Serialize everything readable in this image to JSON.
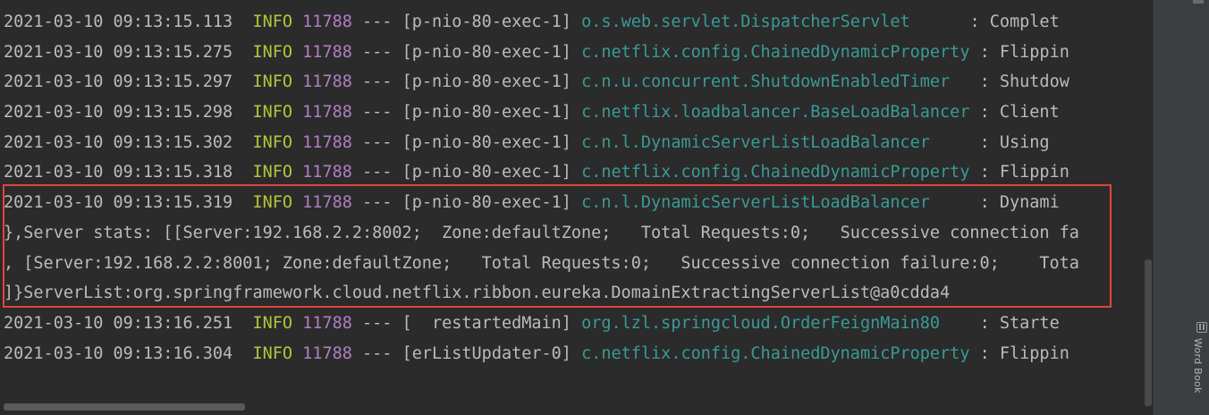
{
  "log_lines": [
    {
      "ts": "2021-03-10 09:13:15.113",
      "level": "INFO",
      "pid": "11788",
      "sep": "---",
      "thread": "[p-nio-80-exec-1]",
      "logger": "o.s.web.servlet.DispatcherServlet",
      "msg": ": Complet"
    },
    {
      "ts": "2021-03-10 09:13:15.275",
      "level": "INFO",
      "pid": "11788",
      "sep": "---",
      "thread": "[p-nio-80-exec-1]",
      "logger": "c.netflix.config.ChainedDynamicProperty",
      "msg": ": Flippin"
    },
    {
      "ts": "2021-03-10 09:13:15.297",
      "level": "INFO",
      "pid": "11788",
      "sep": "---",
      "thread": "[p-nio-80-exec-1]",
      "logger": "c.n.u.concurrent.ShutdownEnabledTimer",
      "msg": ": Shutdow"
    },
    {
      "ts": "2021-03-10 09:13:15.298",
      "level": "INFO",
      "pid": "11788",
      "sep": "---",
      "thread": "[p-nio-80-exec-1]",
      "logger": "c.netflix.loadbalancer.BaseLoadBalancer",
      "msg": ": Client"
    },
    {
      "ts": "2021-03-10 09:13:15.302",
      "level": "INFO",
      "pid": "11788",
      "sep": "---",
      "thread": "[p-nio-80-exec-1]",
      "logger": "c.n.l.DynamicServerListLoadBalancer",
      "msg": ": Using"
    },
    {
      "ts": "2021-03-10 09:13:15.318",
      "level": "INFO",
      "pid": "11788",
      "sep": "---",
      "thread": "[p-nio-80-exec-1]",
      "logger": "c.netflix.config.ChainedDynamicProperty",
      "msg": ": Flippin"
    },
    {
      "ts": "2021-03-10 09:13:15.319",
      "level": "INFO",
      "pid": "11788",
      "sep": "---",
      "thread": "[p-nio-80-exec-1]",
      "logger": "c.n.l.DynamicServerListLoadBalancer",
      "msg": ": Dynami"
    },
    {
      "text": "},Server stats: [[Server:192.168.2.2:8002;  Zone:defaultZone;   Total Requests:0;   Successive connection fa"
    },
    {
      "text": ", [Server:192.168.2.2:8001; Zone:defaultZone;   Total Requests:0;   Successive connection failure:0;    Tota"
    },
    {
      "text": "]}ServerList:org.springframework.cloud.netflix.ribbon.eureka.DomainExtractingServerList@a0cdda4"
    },
    {
      "ts": "2021-03-10 09:13:16.251",
      "level": "INFO",
      "pid": "11788",
      "sep": "---",
      "thread": "[  restartedMain]",
      "logger": "org.lzl.springcloud.OrderFeignMain80",
      "msg": ": Starte"
    },
    {
      "ts": "2021-03-10 09:13:16.304",
      "level": "INFO",
      "pid": "11788",
      "sep": "---",
      "thread": "[erListUpdater-0]",
      "logger": "c.netflix.config.ChainedDynamicProperty",
      "msg": ": Flippin"
    }
  ],
  "side_panel": {
    "word_book_label": "Word Book"
  },
  "colors": {
    "background": "#2b2b2b",
    "text": "#bbbbbb",
    "info": "#b4c43b",
    "pid": "#b07ec4",
    "logger": "#3a9a96",
    "highlight": "#e0443e"
  }
}
